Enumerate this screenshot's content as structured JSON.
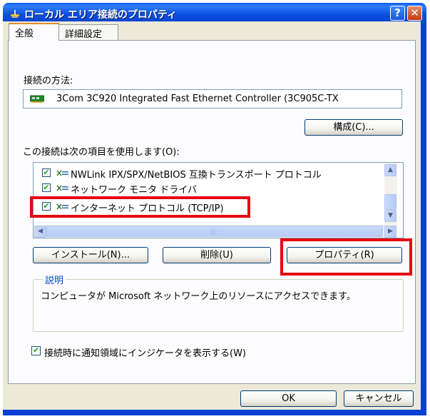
{
  "window": {
    "title": "ローカル エリア接続のプロパティ",
    "help_glyph": "?",
    "close_glyph": "✕"
  },
  "tabs": [
    {
      "label": "全般",
      "active": true
    },
    {
      "label": "詳細設定",
      "active": false
    }
  ],
  "connection": {
    "method_label": "接続の方法:",
    "adapter": "3Com 3C920 Integrated Fast Ethernet Controller (3C905C-TX",
    "configure_button": "構成(C)..."
  },
  "items": {
    "label": "この接続は次の項目を使用します(O):",
    "list": [
      {
        "label": "NWLink IPX/SPX/NetBIOS 互換トランスポート プロトコル",
        "checked": true
      },
      {
        "label": "ネットワーク モニタ ドライバ",
        "checked": true
      },
      {
        "label": "インターネット プロトコル (TCP/IP)",
        "checked": true
      }
    ]
  },
  "buttons": {
    "install": "インストール(N)...",
    "uninstall": "削除(U)",
    "properties": "プロパティ(R)"
  },
  "description": {
    "title": "説明",
    "text": "コンピュータが Microsoft ネットワーク上のリソースにアクセスできます。"
  },
  "notify": {
    "label": "接続時に通知領域にインジケータを表示する(W)",
    "checked": true
  },
  "footer": {
    "ok": "OK",
    "cancel": "キャンセル"
  },
  "highlight_color": "#e60012"
}
